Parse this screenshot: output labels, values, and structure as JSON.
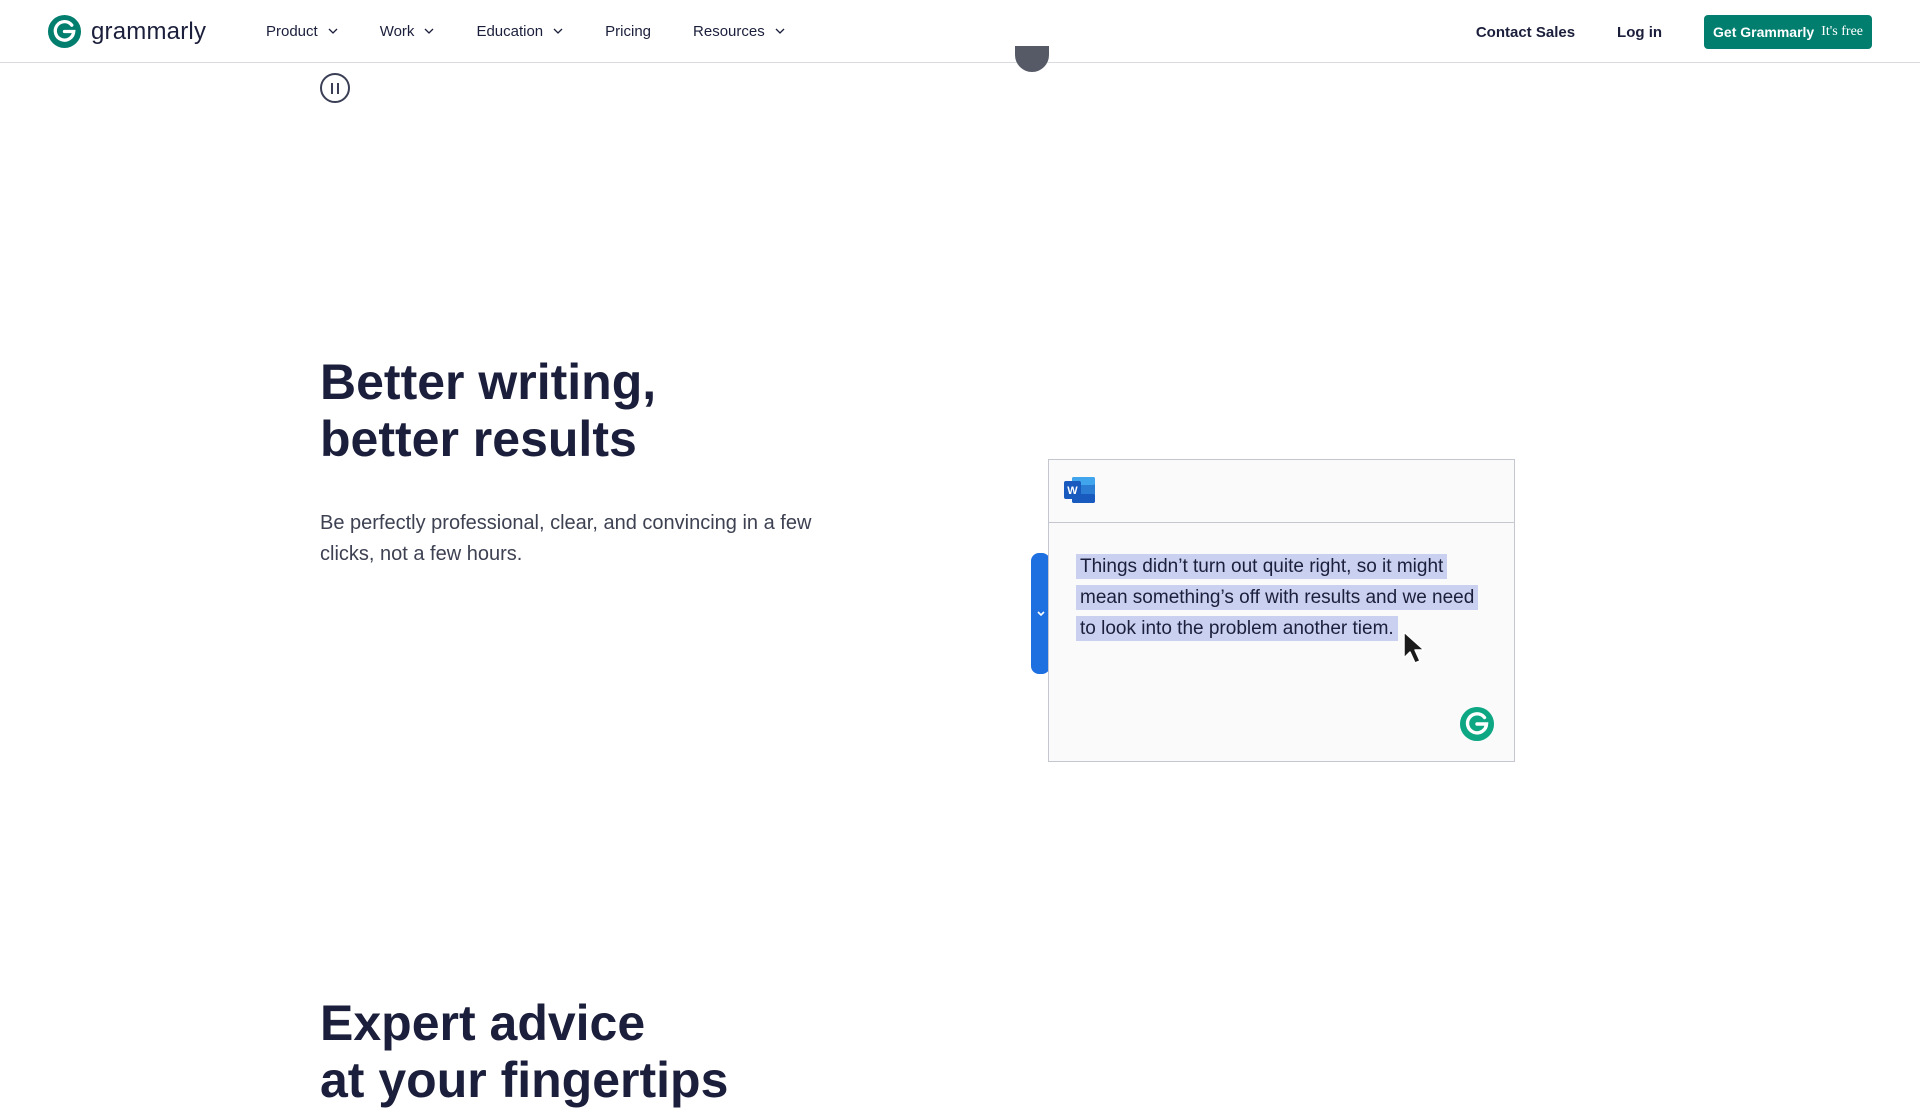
{
  "brand": {
    "name": "grammarly",
    "color": "#027e6f"
  },
  "nav": {
    "items": [
      {
        "label": "Product",
        "has_dropdown": true
      },
      {
        "label": "Work",
        "has_dropdown": true
      },
      {
        "label": "Education",
        "has_dropdown": true
      },
      {
        "label": "Pricing",
        "has_dropdown": false
      },
      {
        "label": "Resources",
        "has_dropdown": true
      }
    ],
    "contact_sales": "Contact Sales",
    "log_in": "Log in",
    "cta_main": "Get Grammarly",
    "cta_free": "It's free"
  },
  "hero": {
    "title_line1": "Better writing,",
    "title_line2": "better results",
    "subtitle": "Be perfectly professional, clear, and convincing in a few clicks, not a few hours.",
    "demo_text": "Things didn’t turn out quite right, so it might mean something’s off with results and we need to look into the problem another tiem."
  },
  "section2": {
    "title_line1": "Expert advice",
    "title_line2": "at your fingertips"
  },
  "icons": {
    "pause": "pause-icon",
    "word": "microsoft-word-icon",
    "grammarly": "grammarly-g-icon",
    "cursor": "mouse-cursor-icon"
  },
  "colors": {
    "highlight": "#c9d0f0",
    "sidebar_blue": "#1e6fe0",
    "text": "#1b1f3b"
  }
}
